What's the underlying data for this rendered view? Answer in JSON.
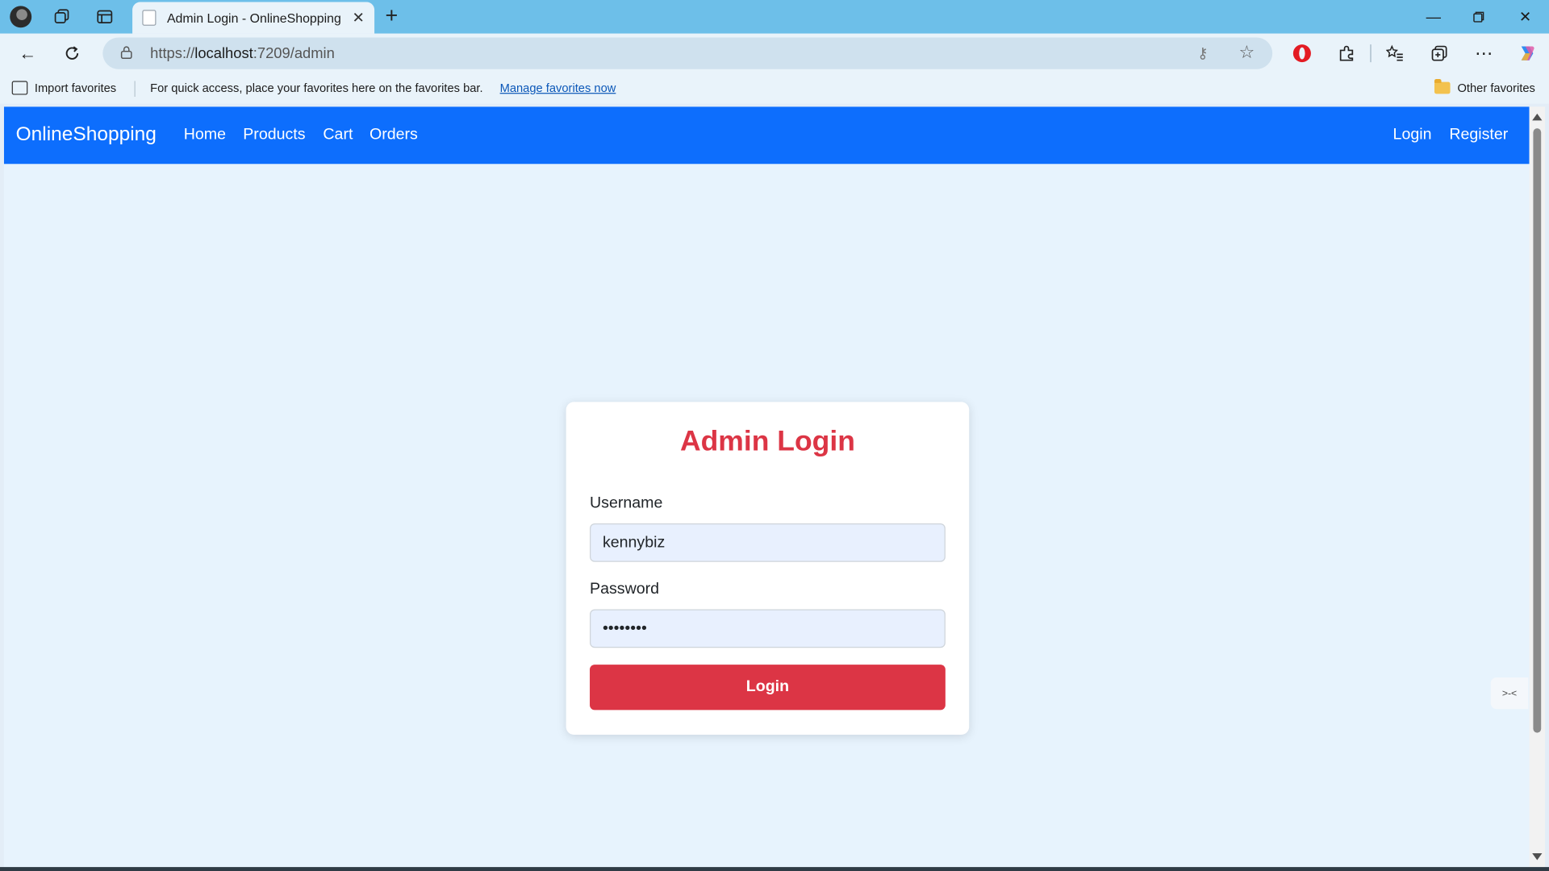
{
  "browser": {
    "tab_title": "Admin Login - OnlineShopping",
    "url_scheme": "https://",
    "url_host": "localhost",
    "url_path": ":7209/admin",
    "icons": [
      "profile-avatar",
      "workspaces-icon",
      "vertical-tabs-icon",
      "close-icon",
      "plus-icon",
      "minimize-icon",
      "restore-icon",
      "back-icon",
      "refresh-icon",
      "lock-icon",
      "key-icon",
      "star-icon",
      "extensions-icon",
      "favorites-icon",
      "collections-icon",
      "more-icon",
      "copilot-icon"
    ]
  },
  "favorites_bar": {
    "import_label": "Import favorites",
    "message": "For quick access, place your favorites here on the favorites bar.",
    "manage_link": "Manage favorites now",
    "other_label": "Other favorites"
  },
  "site_nav": {
    "brand": "OnlineShopping",
    "links": [
      "Home",
      "Products",
      "Cart",
      "Orders"
    ],
    "right_links": [
      "Login",
      "Register"
    ],
    "bg_color": "#0d6efd"
  },
  "login_card": {
    "title": "Admin Login",
    "username_label": "Username",
    "username_value": "kennybiz",
    "password_label": "Password",
    "password_value": "••••••••",
    "submit_label": "Login",
    "accent_color": "#dc3545"
  },
  "side_widget": {
    "text": ">-<"
  }
}
